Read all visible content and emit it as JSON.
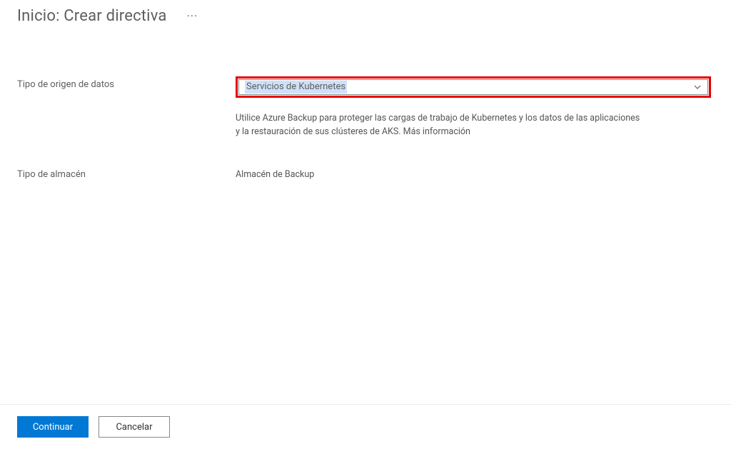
{
  "header": {
    "title": "Inicio: Crear directiva"
  },
  "form": {
    "datasource_type": {
      "label": "Tipo de origen de datos",
      "selected": "Servicios de Kubernetes"
    },
    "description_line1": "Utilice Azure Backup para proteger las cargas de trabajo de Kubernetes y los datos de las aplicaciones",
    "description_line2": "y la restauración de sus clústeres de AKS. Más información",
    "store_type": {
      "label": "Tipo de almacén",
      "value": "Almacén de Backup"
    }
  },
  "footer": {
    "continue_label": "Continuar",
    "cancel_label": "Cancelar"
  }
}
